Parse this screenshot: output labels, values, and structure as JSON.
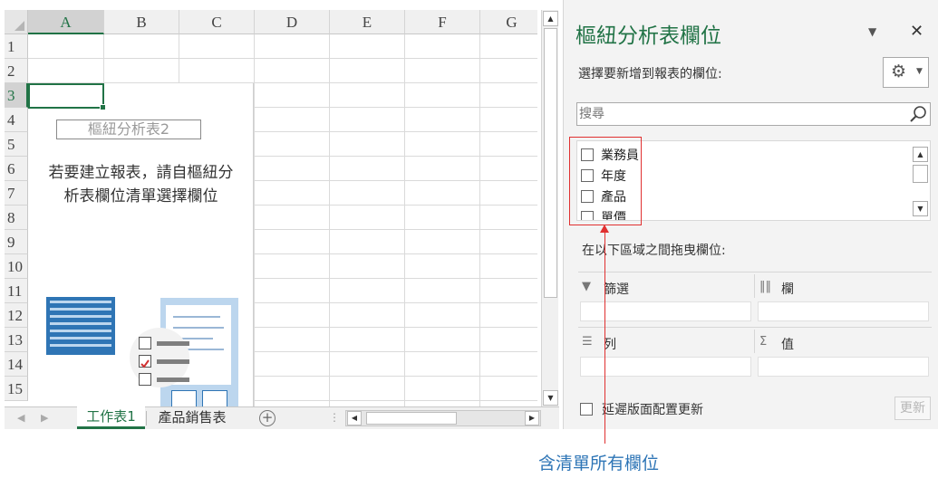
{
  "sheet": {
    "columns": [
      "A",
      "B",
      "C",
      "D",
      "E",
      "F",
      "G"
    ],
    "rows": [
      "1",
      "2",
      "3",
      "4",
      "5",
      "6",
      "7",
      "8",
      "9",
      "10",
      "11",
      "12",
      "13",
      "14",
      "15"
    ],
    "active_cell": "A3"
  },
  "pivot_placeholder": {
    "name": "樞紐分析表2",
    "message_line1": "若要建立報表，請自樞紐分",
    "message_line2": "析表欄位清單選擇欄位"
  },
  "sheet_tabs": [
    {
      "label": "工作表1",
      "active": true
    },
    {
      "label": "產品銷售表",
      "active": false
    }
  ],
  "pane": {
    "title": "樞紐分析表欄位",
    "choose_fields_label": "選擇要新增到報表的欄位:",
    "search_placeholder": "搜尋",
    "fields": [
      {
        "label": "業務員",
        "checked": false
      },
      {
        "label": "年度",
        "checked": false
      },
      {
        "label": "產品",
        "checked": false
      },
      {
        "label": "單價",
        "checked": false
      }
    ],
    "drag_label": "在以下區域之間拖曳欄位:",
    "areas": {
      "filters": "篩選",
      "columns": "欄",
      "rows": "列",
      "values": "值"
    },
    "defer_label": "延遲版面配置更新",
    "update_button": "更新"
  },
  "annotation": "含清單所有欄位",
  "icons": {
    "gear": "gear-icon",
    "search": "search-icon",
    "close": "close-icon",
    "filter": "filter-icon",
    "columns": "columns-icon",
    "rows": "rows-icon",
    "sigma": "sigma-icon"
  },
  "colors": {
    "excel_green": "#217346",
    "annotation_red": "#e03030",
    "annotation_blue": "#2e75b6"
  }
}
